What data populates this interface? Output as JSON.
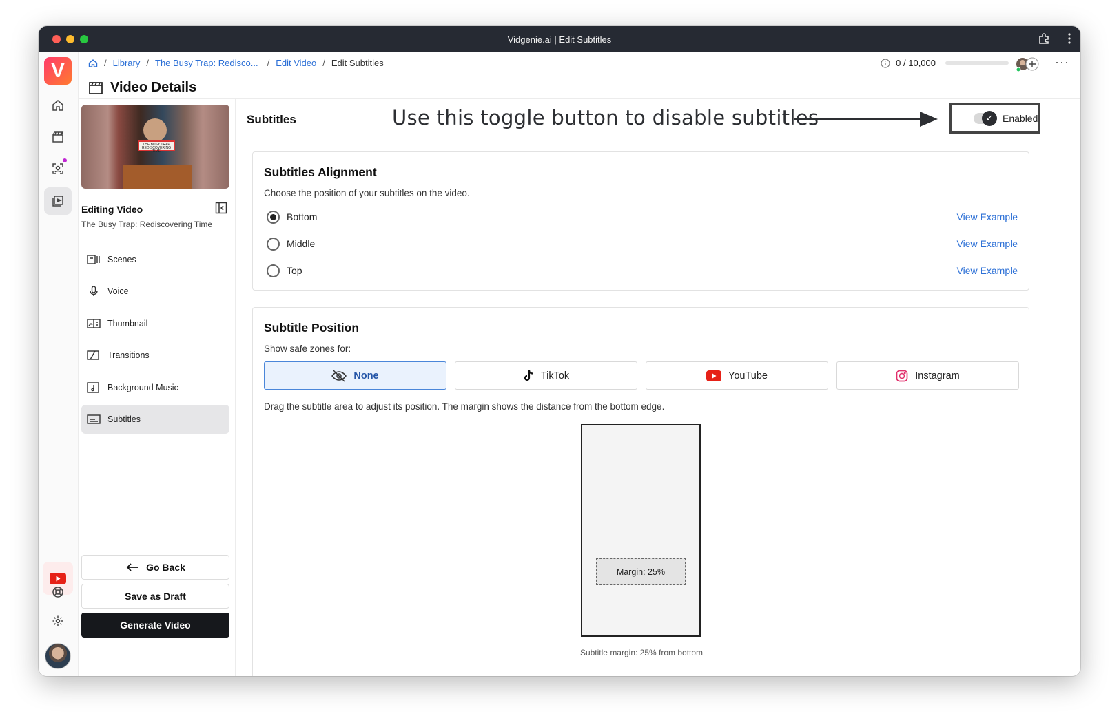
{
  "window": {
    "title": "Vidgenie.ai | Edit Subtitles"
  },
  "brand": {
    "logo_letter": "V",
    "accent": "#ff3b6b"
  },
  "breadcrumb": {
    "items": [
      "Library",
      "The Busy Trap: Redisco...",
      "Edit Video"
    ],
    "current": "Edit Subtitles",
    "separator": "/"
  },
  "credits": {
    "text": "0 / 10,000",
    "used": 0,
    "total": 10000
  },
  "header": {
    "title": "Video Details"
  },
  "editing": {
    "heading": "Editing Video",
    "video_title": "The Busy Trap: Rediscovering Time",
    "thumbnail_sign": "THE BUSY TRAP REDISCOVERING TIME"
  },
  "nav": {
    "items": [
      {
        "label": "Scenes",
        "icon": "scenes-icon"
      },
      {
        "label": "Voice",
        "icon": "microphone-icon"
      },
      {
        "label": "Thumbnail",
        "icon": "thumbnail-icon"
      },
      {
        "label": "Transitions",
        "icon": "transitions-icon"
      },
      {
        "label": "Background Music",
        "icon": "music-icon"
      },
      {
        "label": "Subtitles",
        "icon": "subtitles-icon",
        "active": true
      }
    ]
  },
  "actions": {
    "go_back": "Go Back",
    "save_draft": "Save as Draft",
    "generate": "Generate Video"
  },
  "subtitles": {
    "title": "Subtitles",
    "annotation": "Use this toggle button to disable subtitles",
    "toggle_label": "Enabled",
    "toggle_on": true
  },
  "alignment": {
    "title": "Subtitles Alignment",
    "description": "Choose the position of your subtitles on the video.",
    "options": [
      {
        "label": "Bottom",
        "selected": true,
        "link": "View Example"
      },
      {
        "label": "Middle",
        "selected": false,
        "link": "View Example"
      },
      {
        "label": "Top",
        "selected": false,
        "link": "View Example"
      }
    ]
  },
  "position": {
    "title": "Subtitle Position",
    "safe_zones_label": "Show safe zones for:",
    "zones": [
      {
        "label": "None",
        "icon": "eye-off-icon",
        "selected": true
      },
      {
        "label": "TikTok",
        "icon": "tiktok-icon",
        "selected": false
      },
      {
        "label": "YouTube",
        "icon": "youtube-icon",
        "selected": false
      },
      {
        "label": "Instagram",
        "icon": "instagram-icon",
        "selected": false
      }
    ],
    "instructions": "Drag the subtitle area to adjust its position. The margin shows the distance from the bottom edge.",
    "margin_label": "Margin: 25%",
    "margin_percent": 25,
    "caption": "Subtitle margin: 25% from bottom"
  }
}
